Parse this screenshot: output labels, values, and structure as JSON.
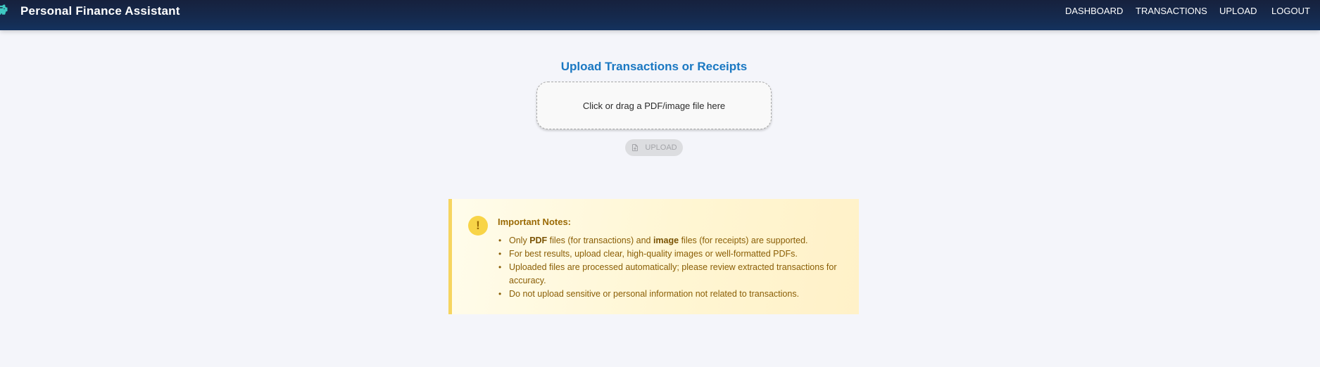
{
  "header": {
    "brand_title": "Personal Finance Assistant",
    "brand_icon": "piggy-bank-icon",
    "nav": [
      {
        "label": "DASHBOARD"
      },
      {
        "label": "TRANSACTIONS"
      },
      {
        "label": "UPLOAD"
      },
      {
        "label": "LOGOUT"
      }
    ]
  },
  "upload": {
    "title": "Upload Transactions or Receipts",
    "dropzone_text": "Click or drag a PDF/image file here",
    "button_label": "UPLOAD",
    "button_icon": "file-upload-icon",
    "button_disabled": true
  },
  "notes": {
    "icon": "warning-icon",
    "icon_text": "!",
    "title": "Important Notes:",
    "items": [
      {
        "parts": [
          "Only ",
          "PDF",
          " files (for transactions) and ",
          "image",
          " files (for receipts) are supported."
        ]
      },
      {
        "text": "For best results, upload clear, high-quality images or well-formatted PDFs."
      },
      {
        "text": "Uploaded files are processed automatically; please review extracted transactions for accuracy."
      },
      {
        "text": "Do not upload sensitive or personal information not related to transactions."
      }
    ]
  },
  "colors": {
    "header_bg": "#16213d",
    "accent_blue": "#1a78c2",
    "notes_border": "#f6d560",
    "notes_text": "#8a5e05",
    "brand_icon": "#3ec8c2"
  }
}
